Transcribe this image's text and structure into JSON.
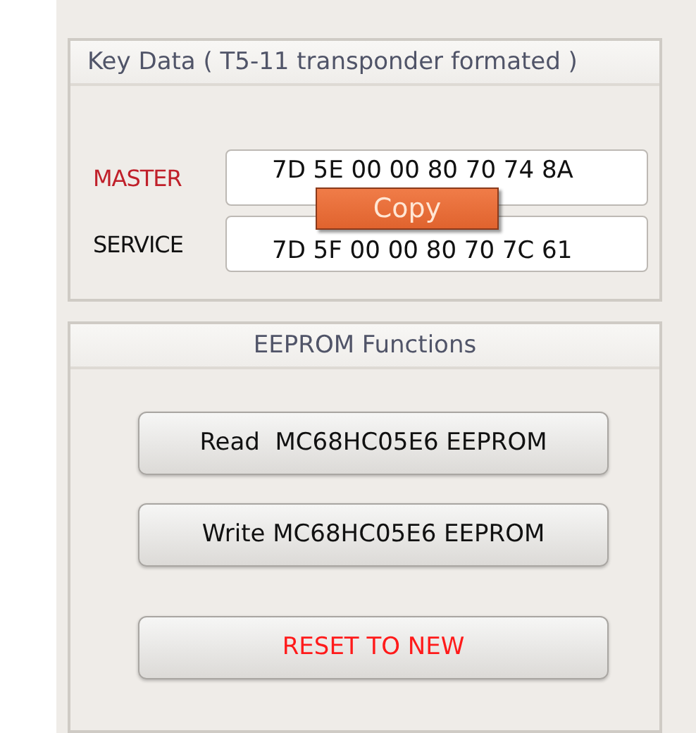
{
  "key_data": {
    "title": "Key Data ( T5-11 transponder formated )",
    "fields": [
      {
        "label": "MASTER",
        "value": "7D 5E 00 00 80 70 74 8A",
        "color": "#c0202a"
      },
      {
        "label": "SERVICE",
        "value": "7D 5F 00 00 80 70 7C 61",
        "color": "#111111"
      }
    ]
  },
  "context_menu": {
    "label": "Copy"
  },
  "eeprom": {
    "title": "EEPROM Functions",
    "buttons": [
      {
        "label": "Read  MC68HC05E6 EEPROM",
        "color": "#111111"
      },
      {
        "label": "Write MC68HC05E6 EEPROM",
        "color": "#111111"
      },
      {
        "label": "RESET TO NEW",
        "color": "#ff1a1a"
      }
    ]
  }
}
